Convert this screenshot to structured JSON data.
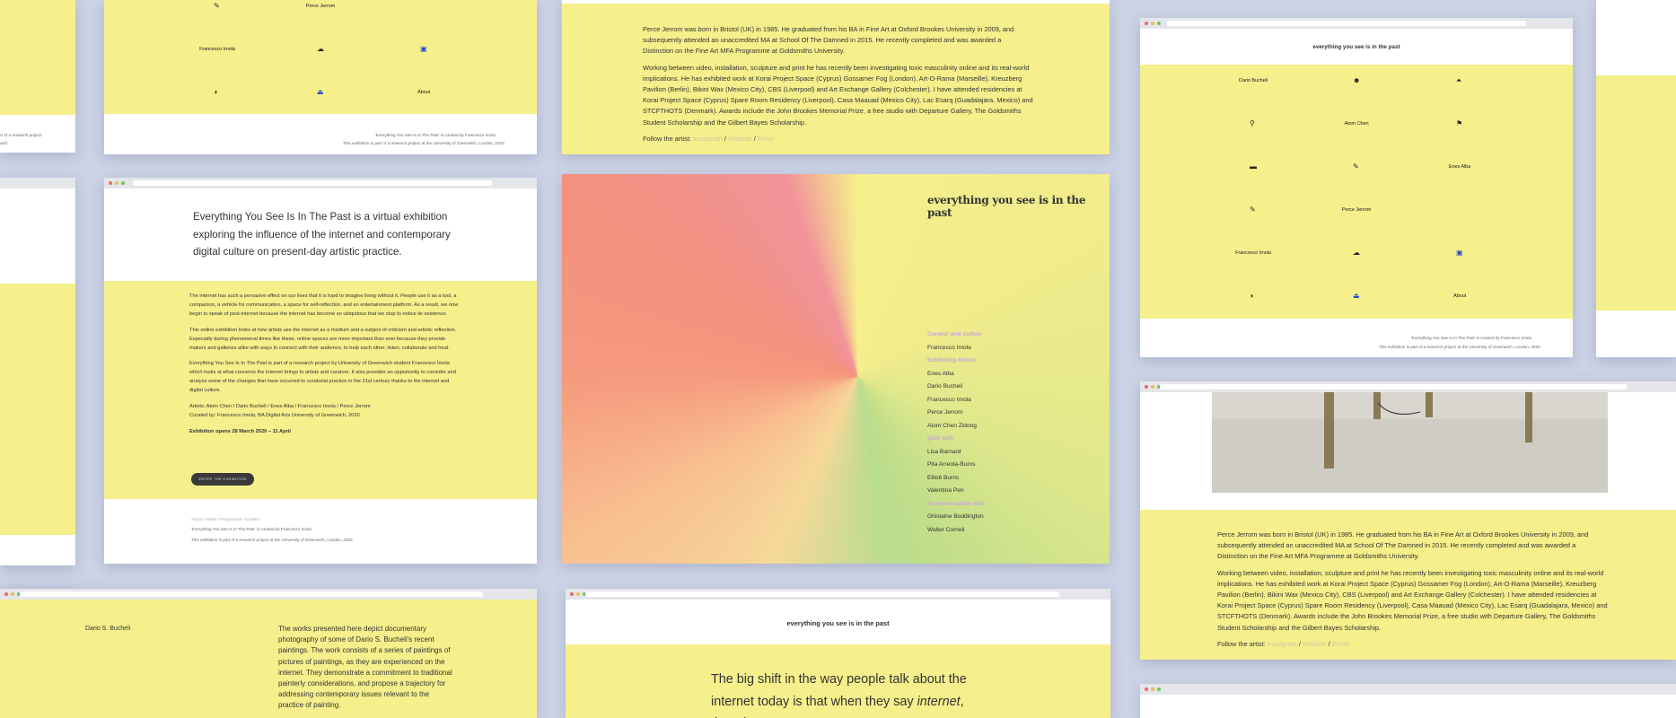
{
  "site": {
    "title": "everything you see is in the past",
    "footer_line1": "'Everything You See Is In The Past' is curated by Francesco Imola",
    "footer_line2": "This exhibition is part of a research project at the University of Greenwich, London, 2020",
    "footer_nav": "About / Artists / Programme / Contact"
  },
  "grid_menu": {
    "items": [
      "Dario Bucheli",
      "Atom Chen",
      "Enes Alba",
      "Perce Jerrom",
      "Francesco Imola",
      "About"
    ],
    "icons": [
      "smiley-icon",
      "eject-icon",
      "sunglasses-icon",
      "flag-icon",
      "laptop-icon",
      "pencil-icon",
      "cloud-icon",
      "puzzle-icon",
      "speaker-icon",
      "shoe-icon"
    ]
  },
  "perce": {
    "p1": "Perce Jerrom was born in Bristol (UK) in 1985. He graduated from his BA in Fine Art at Oxford Brookes University in 2009, and subsequently attended an unaccredited MA at School Of The Damned in 2015. He recently completed and was awarded a Distinction on the Fine Art MFA Programme at Goldsmiths University.",
    "p2": "Working between video, installation, sculpture and print he has recently been investigating toxic masculinity online and its real-world implications. He has exhibited work at Korai Project Space (Cyprus) Gossamer Fog (London), Art-O-Rama (Marseille), Kreuzberg Pavilion (Berlin), Bikini Wax (Mexico City), CBS (Liverpool) and Art Exchange Gallery (Colchester). I have attended residencies at Korai Project Space (Cyprus) Spare Room Residency (Liverpool), Casa Maauad (Mexico City), Lac Esarq (Guadalajara, Mexico) and STCFTHOTS (Denmark). Awards include the John Brookes Memorial Prize, a free studio with Departure Gallery, The Goldsmiths Student Scholarship and the Gilbert Bayes Scholarship.",
    "follow_label": "Follow the artist:",
    "links": [
      "Instagram",
      "Website",
      "Email"
    ],
    "sep": "/"
  },
  "intro": {
    "headline": "Everything You See Is In The Past is a virtual exhibition exploring the influence of the internet and contemporary digital culture on present-day artistic practice.",
    "p1": "The internet has such a pervasive effect on our lives that it is hard to imagine living without it. People use it as a tool, a companion, a vehicle for communication, a space for self-reflection, and an entertainment platform. As a result, we now begin to speak of post-internet because the internet has become so ubiquitous that we stop to notice its existence.",
    "p2": "This online exhibition looks at how artists use the internet as a medium and a subject of criticism and artistic reflection. Especially during phenomenal times like these, online spaces are more important than ever because they provide makers and galleries alike with ways to connect with their audience, to help each other, listen, collaborate and heal.",
    "p3": "Everything You See Is In The Past is part of a research project by University of Greenwich student Francesco Imola which looks at what concerns the internet brings to artists and curators. It also provides an opportunity to consider and analyse some of the changes that have occurred to curatorial practice in the 21st century thanks to the internet and digital culture.",
    "p4": "Artists: Atom Chen / Dario Bucheli / Enes Alba / Francesco Imola / Perce Jerrom",
    "p5": "Curated by: Francesco Imola, BA Digital Arts University of Greenwich, 2020",
    "opens": "Exhibition opens 28 March 2020 – 11 April",
    "button": "Enter the Exhibition"
  },
  "credits": {
    "title": "everything you see is in the past",
    "sections": [
      {
        "heading": "Curator and Author",
        "names": [
          "Francesco Imola"
        ]
      },
      {
        "heading": "Exhibiting Artists",
        "names": [
          "Enes Alba",
          "Dario Bucheli",
          "Francesco Imola",
          "Perce Jerrom",
          "Atom Chen Zidong"
        ]
      },
      {
        "heading": "Q&A with",
        "names": [
          "Lisa Barnard",
          "Pita Arreola-Burns",
          "Elliott Burns",
          "Valentina Peri"
        ]
      },
      {
        "heading": "In conversation with",
        "names": [
          "Ghislaine Boddington",
          "Walter Corneli"
        ]
      }
    ]
  },
  "dario": {
    "name": "Dario S. Bucheli",
    "text": "The works presented here depict documentary photography of some of Dario S. Bucheli's recent paintings. The work consists of a series of paintings of pictures of paintings, as they are experienced on the internet. They demonstrate a commitment to traditional painterly considerations, and propose a trajectory for addressing contemporary issues relevant to the practice of painting."
  },
  "quote": {
    "before": "The big shift in the way people talk about the internet today is that when they say ",
    "em": "internet",
    "after": ", they do not"
  },
  "colors": {
    "background": "#ccd3e6",
    "yellow": "#f5ef8c",
    "button": "#3a3a3a",
    "link": "#d2c8a0",
    "heading": "#c7a5d8"
  }
}
